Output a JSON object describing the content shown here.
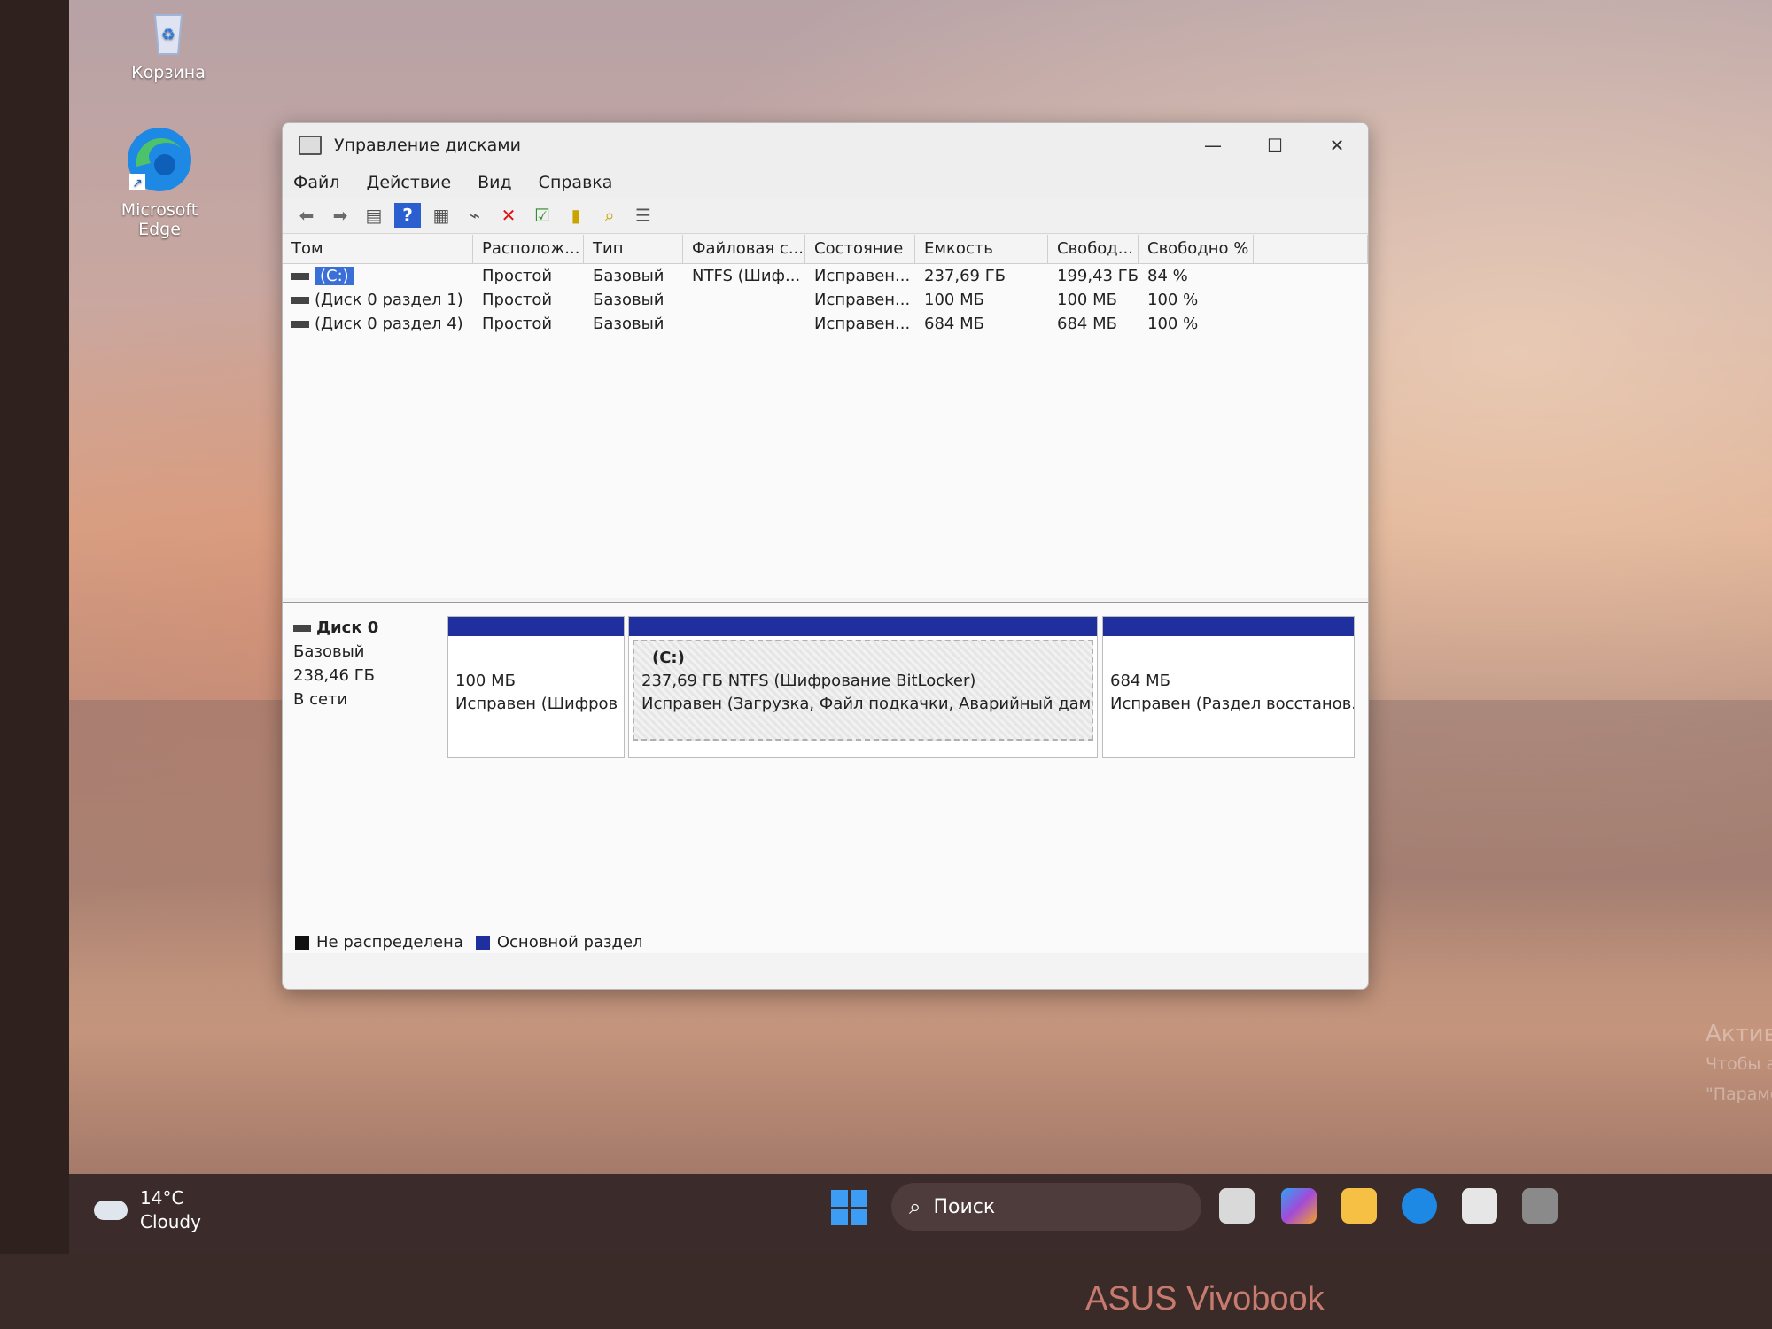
{
  "desktop": {
    "icons": [
      {
        "label": "Корзина",
        "icon": "recycle-bin-icon"
      },
      {
        "label": "Microsoft Edge",
        "icon": "edge-icon"
      }
    ],
    "activation_watermark": [
      "Актив",
      "Чтобы а",
      "\"Параме"
    ]
  },
  "window": {
    "title": "Управление дисками",
    "menu": [
      "Файл",
      "Действие",
      "Вид",
      "Справка"
    ],
    "toolbar": [
      "back-icon",
      "forward-icon",
      "console-tree-icon",
      "help-icon",
      "properties-icon",
      "connect-icon",
      "delete-icon",
      "check-icon",
      "new-volume-icon",
      "search-volume-icon",
      "view-icon"
    ],
    "columns": [
      "Том",
      "Располож...",
      "Тип",
      "Файловая с...",
      "Состояние",
      "Емкость",
      "Свобод...",
      "Свободно %",
      ""
    ],
    "volumes": [
      {
        "name": "(C:)",
        "layout": "Простой",
        "type": "Базовый",
        "fs": "NTFS (Шиф...",
        "status": "Исправен...",
        "capacity": "237,69 ГБ",
        "free": "199,43 ГБ",
        "free_pct": "84 %"
      },
      {
        "name": "(Диск 0 раздел 1)",
        "layout": "Простой",
        "type": "Базовый",
        "fs": "",
        "status": "Исправен...",
        "capacity": "100 МБ",
        "free": "100 МБ",
        "free_pct": "100 %"
      },
      {
        "name": "(Диск 0 раздел 4)",
        "layout": "Простой",
        "type": "Базовый",
        "fs": "",
        "status": "Исправен...",
        "capacity": "684 МБ",
        "free": "684 МБ",
        "free_pct": "100 %"
      }
    ],
    "disk": {
      "name": "Диск 0",
      "type": "Базовый",
      "size": "238,46 ГБ",
      "state": "В сети",
      "partitions": [
        {
          "label": "",
          "size": "100 МБ",
          "status": "Исправен (Шифров"
        },
        {
          "label": "(C:)",
          "size": "237,69 ГБ NTFS (Шифрование BitLocker)",
          "status": "Исправен (Загрузка, Файл подкачки, Аварийный дамп па"
        },
        {
          "label": "",
          "size": "684 МБ",
          "status": "Исправен (Раздел восстанов."
        }
      ]
    },
    "legend": [
      {
        "label": "Не распределена",
        "color": "#111111"
      },
      {
        "label": "Основной раздел",
        "color": "#1f2f9e"
      }
    ]
  },
  "taskbar": {
    "temp": "14°C",
    "condition": "Cloudy",
    "search_placeholder": "Поиск"
  },
  "device_brand": "ASUS Vivobook"
}
